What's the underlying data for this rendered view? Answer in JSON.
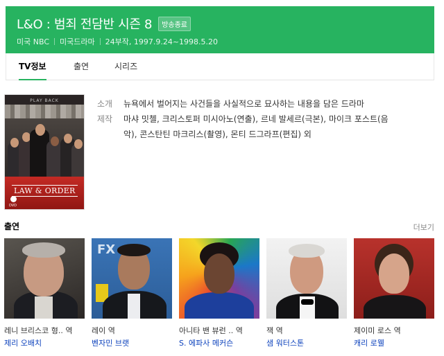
{
  "header": {
    "title": "L&O : 범죄 전담반 시즌 8",
    "badge": "방송종료",
    "meta": [
      "미국 NBC",
      "미국드라마",
      "24부작, 1997.9.24~1998.5.20"
    ],
    "bg_color": "#27b360"
  },
  "tabs": [
    {
      "label": "TV정보",
      "active": true
    },
    {
      "label": "출연",
      "active": false
    },
    {
      "label": "시리즈",
      "active": false
    }
  ],
  "poster": {
    "top_text": "PLAY BACK",
    "logo_text": "LAW & ORDER",
    "bottom_text": "DVD"
  },
  "info": {
    "synopsis_label": "소개",
    "synopsis": "뉴욕에서 벌어지는 사건들을 사실적으로 묘사하는 내용을 담은 드라마",
    "production_label": "제작",
    "production_line1": "마샤 밋첼, 크리스토퍼 미시아노(연출), 르네 발세르(극본), 마이크 포스트(음",
    "production_line2": "악), 콘스탄틴 마크리스(촬영), 몬티 드그라프(편집) 외"
  },
  "cast": {
    "heading": "출연",
    "more_label": "더보기",
    "items": [
      {
        "role": "레니 브리스코 형.. 역",
        "name": "제리 오배치"
      },
      {
        "role": "레이 역",
        "name": "벤자민 브랫"
      },
      {
        "role": "아니타 밴 뷰런 .. 역",
        "name": "S. 에파사 메커슨"
      },
      {
        "role": "잭 역",
        "name": "샘 워터스톤"
      },
      {
        "role": "제이미 로스 역",
        "name": "캐리 로웰"
      }
    ]
  }
}
